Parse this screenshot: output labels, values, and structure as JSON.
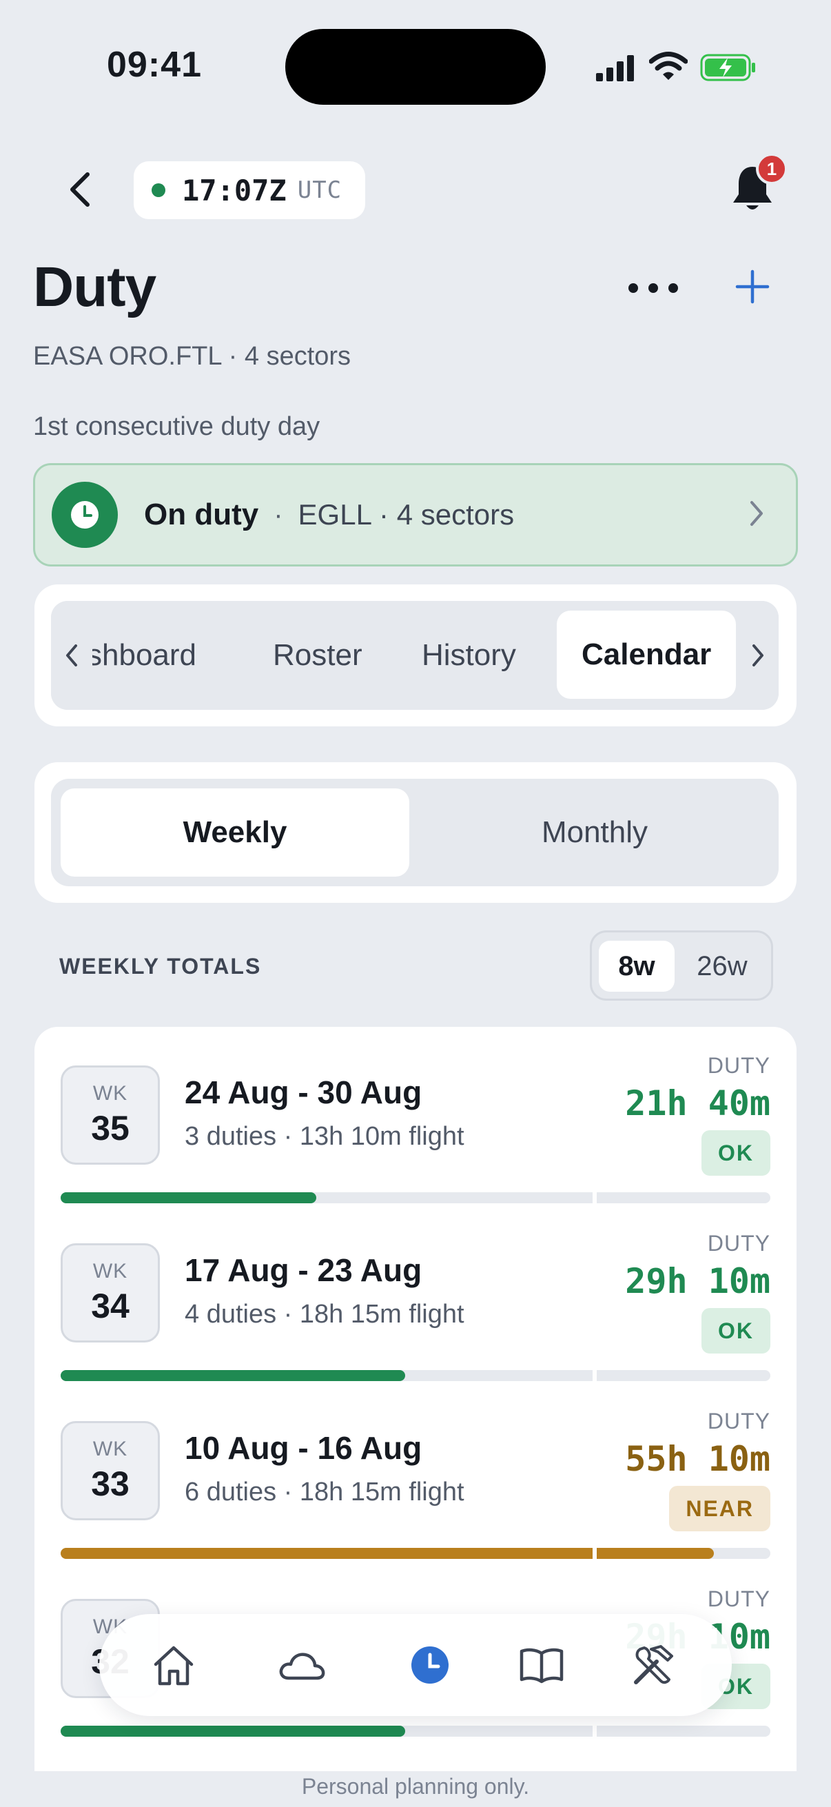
{
  "status_bar": {
    "time": "09:41"
  },
  "header": {
    "utc_time": "17:07Z",
    "utc_label": "UTC",
    "notification_count": "1",
    "title": "Duty",
    "subtitle": "EASA ORO.FTL · 4 sectors",
    "duty_day": "1st consecutive duty day"
  },
  "banner": {
    "status": "On duty",
    "separator": "·",
    "detail": "EGLL · 4 sectors"
  },
  "tabs": {
    "items": [
      {
        "label": "shboard"
      },
      {
        "label": "Roster"
      },
      {
        "label": "History"
      },
      {
        "label": "Calendar"
      }
    ],
    "active": "Calendar"
  },
  "view_toggle": {
    "options": [
      {
        "label": "Weekly"
      },
      {
        "label": "Monthly"
      }
    ],
    "active": "Weekly"
  },
  "totals": {
    "label": "WEEKLY TOTALS",
    "ranges": [
      {
        "label": "8w"
      },
      {
        "label": "26w"
      }
    ],
    "active_range": "8w"
  },
  "weeks": [
    {
      "wk_label": "WK",
      "wk": "35",
      "range": "24 Aug - 30 Aug",
      "meta": "3 duties · 13h 10m flight",
      "duty_caption": "DUTY",
      "duty": "21h 40m",
      "status": "OK",
      "level": 0.36
    },
    {
      "wk_label": "WK",
      "wk": "34",
      "range": "17 Aug - 23 Aug",
      "meta": "4 duties · 18h 15m flight",
      "duty_caption": "DUTY",
      "duty": "29h 10m",
      "status": "OK",
      "level": 0.485
    },
    {
      "wk_label": "WK",
      "wk": "33",
      "range": "10 Aug - 16 Aug",
      "meta": "6 duties · 18h 15m flight",
      "duty_caption": "DUTY",
      "duty": "55h 10m",
      "status": "NEAR",
      "level": 0.92
    },
    {
      "wk_label": "WK",
      "wk": "32",
      "range": "",
      "meta": "",
      "duty_caption": "DUTY",
      "duty": "29h 10m",
      "status": "OK",
      "level": 0.485
    }
  ],
  "colors": {
    "ok": "#1f8a52",
    "near": "#b97f1d",
    "accent": "#2f6fd0"
  },
  "bottom_nav": [
    "home-icon",
    "cloud-icon",
    "clock-icon",
    "book-icon",
    "tools-icon"
  ],
  "footer": {
    "note": "Personal planning only."
  }
}
